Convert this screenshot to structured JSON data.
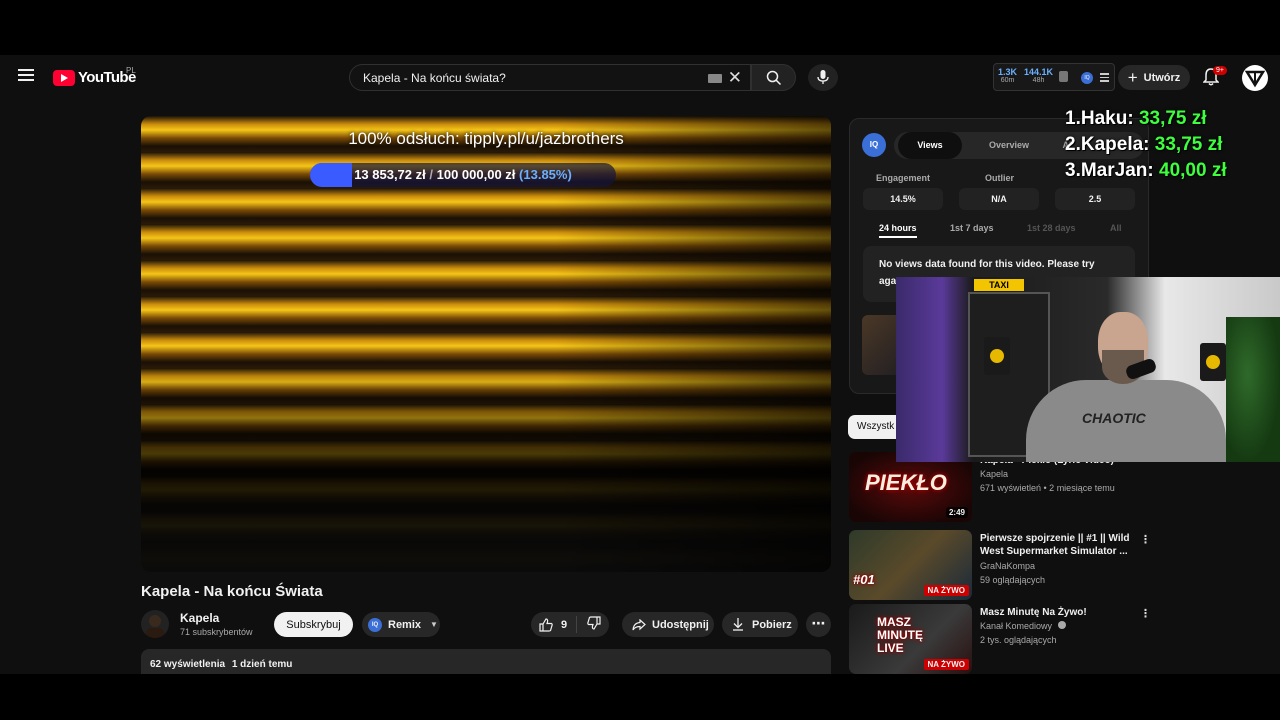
{
  "header": {
    "logo_text": "YouTube",
    "logo_country": "PL",
    "search_value": "Kapela - Na końcu świata?",
    "stats": [
      {
        "value": "1.3K",
        "label": "60m"
      },
      {
        "value": "144.1K",
        "label": "48h"
      }
    ],
    "iq_badge": "IQ",
    "create_label": "Utwórz",
    "notification_count": "9+"
  },
  "player": {
    "tip_text": "100% odsłuch: tipply.pl/u/jazbrothers",
    "goal_raised": "13 853,72 zł",
    "goal_separator": "/",
    "goal_total": "100 000,00 zł",
    "goal_percent_label": "(13.85%)",
    "goal_fraction": 0.1385
  },
  "video": {
    "title": "Kapela - Na końcu Świata",
    "channel": "Kapela",
    "subscribers": "71 subskrybentów",
    "subscribe_label": "Subskrybuj",
    "remix_label": "Remix",
    "remix_badge": "IQ",
    "likes": "9",
    "share_label": "Udostępnij",
    "download_label": "Pobierz",
    "more_label": "⋯",
    "views": "62 wyświetlenia",
    "published": "1 dzień temu"
  },
  "iq_panel": {
    "logo": "IQ",
    "tabs": [
      "Views",
      "Overview",
      "AI"
    ],
    "metrics": [
      {
        "label": "Engagement",
        "value": "14.5%"
      },
      {
        "label": "Outlier",
        "value": "N/A"
      },
      {
        "label": "",
        "value": "2.5"
      }
    ],
    "ranges": [
      "24 hours",
      "1st 7 days",
      "1st 28 days",
      "All"
    ],
    "message_line1": "No views data found for this video. Please try",
    "message_line2": "aga"
  },
  "filter_chip": "Wszystk",
  "recommendations": [
    {
      "title": "Kapela - Piekło (Lyric Video)",
      "channel": "Kapela",
      "meta": "671 wyświetleń • 2 miesiące temu",
      "duration": "2:49",
      "thumb_text": "PIEKŁO",
      "live": ""
    },
    {
      "title": "Pierwsze spojrzenie || #1 || Wild West Supermarket Simulator ...",
      "channel": "GraNaKompa",
      "meta": "59 oglądających",
      "duration": "",
      "thumb_text": "#01",
      "live": "NA ŻYWO"
    },
    {
      "title": "Masz Minutę Na Żywo!",
      "channel": "Kanał Komediowy",
      "meta": "2 tys. oglądających",
      "duration": "",
      "thumb_text": "MASZ MINUTĘ LIVE",
      "live": "NA ŻYWO"
    }
  ],
  "leaderboard": [
    {
      "rank": "1.",
      "name": "Haku:",
      "amount": "33,75 zł"
    },
    {
      "rank": "2.",
      "name": "Kapela:",
      "amount": "33,75 zł"
    },
    {
      "rank": "3.",
      "name": "MarJan:",
      "amount": "40,00 zł"
    }
  ],
  "webcam": {
    "taxi_sign": "TAXI",
    "shirt_text": "CHAOTIC"
  },
  "colors": {
    "accent_red": "#ff0033",
    "goal_blue": "#3a5bff",
    "leaderboard_green": "#3dff3d",
    "iq_blue": "#3b6fd8"
  }
}
